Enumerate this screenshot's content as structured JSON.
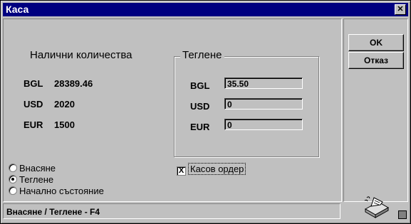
{
  "window": {
    "title": "Каса",
    "close_glyph": "✕"
  },
  "buttons": {
    "ok": "OK",
    "cancel": "Отказ"
  },
  "available": {
    "heading": "Налични количества",
    "rows": [
      {
        "currency": "BGL",
        "value": "28389.46"
      },
      {
        "currency": "USD",
        "value": "2020"
      },
      {
        "currency": "EUR",
        "value": "1500"
      }
    ]
  },
  "withdraw": {
    "title": "Теглене",
    "fields": [
      {
        "currency": "BGL",
        "value": "35.50"
      },
      {
        "currency": "USD",
        "value": "0"
      },
      {
        "currency": "EUR",
        "value": "0"
      }
    ]
  },
  "mode": {
    "options": [
      {
        "label": "Внасяне",
        "checked": false
      },
      {
        "label": "Теглене",
        "checked": true
      },
      {
        "label": "Начално състояние",
        "checked": false
      }
    ]
  },
  "cash_order": {
    "label": "Касов ордер",
    "checked": true,
    "mark": "X"
  },
  "status": {
    "text": "Внасяне / Теглене - F4"
  },
  "icons": {
    "printer": "printer-icon",
    "resize": "resize-grip-icon"
  }
}
